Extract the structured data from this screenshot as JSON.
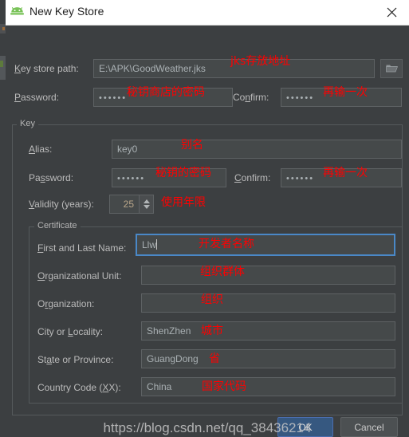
{
  "window": {
    "title": "New Key Store",
    "icon": "android-robot-icon",
    "close_label": "✕"
  },
  "keystore": {
    "path_label_prefix": "K",
    "path_label_rest": "ey store path:",
    "path_value": "E:\\APK\\GoodWeather.jks",
    "path_annotation": "jks存放地址",
    "browse_icon": "folder-icon",
    "password_label_prefix": "P",
    "password_label_rest": "assword:",
    "password_value": "••••••",
    "password_annotation": "秘钥商店的密码",
    "confirm_label_pre": "Co",
    "confirm_label_mid": "n",
    "confirm_label_post": "firm:",
    "confirm_value": "••••••",
    "confirm_annotation": "再输一次"
  },
  "key_group": {
    "title": "Key",
    "alias_label_prefix": "A",
    "alias_label_rest": "lias:",
    "alias_value": "key0",
    "alias_annotation": "别名",
    "password_label_pre": "Pa",
    "password_label_mid": "s",
    "password_label_post": "sword:",
    "password_value": "••••••",
    "password_annotation": "秘钥的密码",
    "confirm_label_prefix": "C",
    "confirm_label_rest": "onfirm:",
    "confirm_value": "••••••",
    "confirm_annotation": "再输一次",
    "validity_label_prefix": "V",
    "validity_label_rest": "alidity (years):",
    "validity_value": "25",
    "validity_annotation": "使用年限"
  },
  "certificate": {
    "title": "Certificate",
    "rows": [
      {
        "label_prefix": "F",
        "label_rest": "irst and Last Name:",
        "value": "Llw",
        "annotation": "开发者名称",
        "focused": true
      },
      {
        "label_prefix": "O",
        "label_rest": "rganizational Unit:",
        "value": "",
        "annotation": "组织群体",
        "focused": false
      },
      {
        "label_pre": "O",
        "label_prefix": "r",
        "label_rest": "ganization:",
        "value": "",
        "annotation": "组织",
        "focused": false
      },
      {
        "label_pre": "City or ",
        "label_prefix": "L",
        "label_rest": "ocality:",
        "value": "ShenZhen",
        "annotation": "城市",
        "focused": false
      },
      {
        "label_pre": "St",
        "label_prefix": "a",
        "label_rest": "te or Province:",
        "value": "GuangDong",
        "annotation": "省",
        "focused": false
      },
      {
        "label_pre": "Country Code (",
        "label_prefix": "X",
        "label_rest": "X):",
        "value": "China",
        "annotation": "国家代码",
        "focused": false
      }
    ]
  },
  "footer": {
    "ok_label": "OK",
    "cancel_label": "Cancel",
    "watermark": "https://blog.csdn.net/qq_38436214"
  },
  "colors": {
    "dialog_bg": "#3c3f41",
    "titlebar_bg": "#ffffff",
    "field_bg": "#45494a",
    "field_border": "#5e6264",
    "focus_border": "#4a88c7",
    "annotation_red": "#ff0000",
    "ok_button_bg": "#365880",
    "ok_button_border": "#4b6eaf",
    "android_green": "#78c257"
  }
}
